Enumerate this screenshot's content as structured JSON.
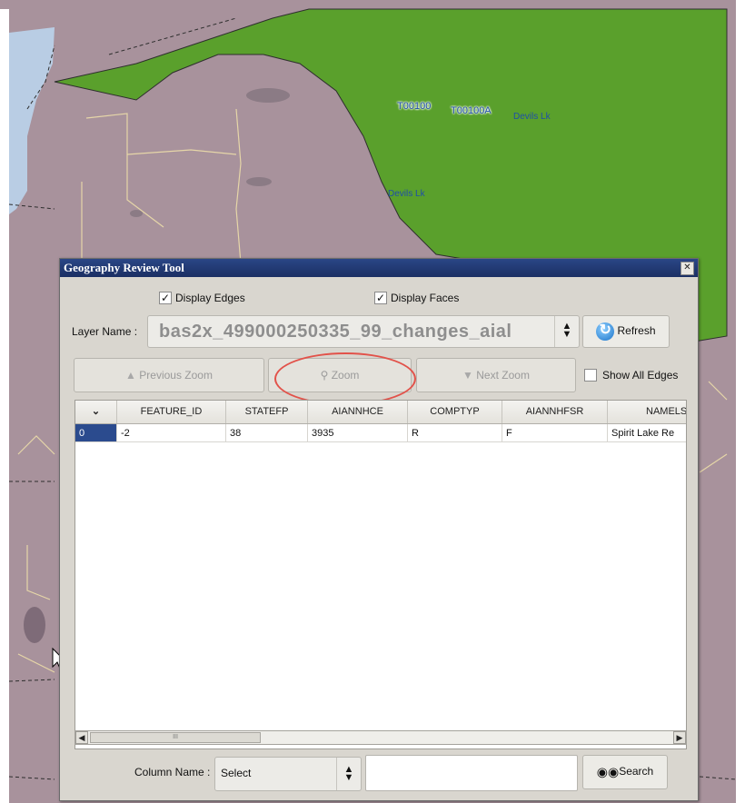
{
  "map": {
    "labels": [
      "T00100",
      "T00100A",
      "Devils Lk",
      "Devils Lk"
    ],
    "colors": {
      "land": "#a8929c",
      "lake": "#b9cde4",
      "reservation": "#5aa02c",
      "roads": "#e6d6a8",
      "boundary": "#2e2e2e"
    }
  },
  "dialog": {
    "title": "Geography Review Tool",
    "close_icon": "close-icon",
    "display_edges": {
      "label": "Display Edges",
      "checked": true
    },
    "display_faces": {
      "label": "Display Faces",
      "checked": true
    },
    "layer_name_label": "Layer Name :",
    "layer_name_value": "bas2x_499000250335_99_changes_aial",
    "refresh_label": "Refresh",
    "previous_zoom_label": "Previous Zoom",
    "zoom_label": "Zoom",
    "next_zoom_label": "Next Zoom",
    "show_all_edges": {
      "label": "Show All Edges",
      "checked": false
    },
    "table": {
      "columns": [
        "FEATURE_ID",
        "STATEFP",
        "AIANNHCE",
        "COMPTYP",
        "AIANNHFSR",
        "NAMELSAD"
      ],
      "rows": [
        {
          "index": "0",
          "cells": [
            "-2",
            "38",
            "3935",
            "R",
            "F",
            "Spirit Lake Re"
          ]
        }
      ]
    },
    "scroll_thumb_grip": "III",
    "column_name_label": "Column Name :",
    "column_name_value": "Select",
    "search_placeholder": "",
    "search_label": "Search",
    "accent_color": "#1b2f63",
    "highlight_color": "#e2524a"
  }
}
